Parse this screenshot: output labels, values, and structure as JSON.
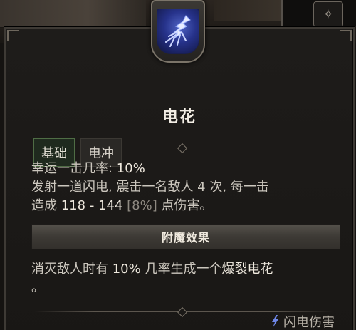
{
  "skill": {
    "name": "电花",
    "icon": "lightning-bolt-icon",
    "icon_colors": {
      "glow": "#4f63c4",
      "deep": "#10153f"
    }
  },
  "tags": [
    {
      "label": "基础",
      "style": "primary"
    },
    {
      "label": "电冲",
      "style": "secondary"
    }
  ],
  "stats": {
    "lucky_hit_label": "幸运一击几率: ",
    "lucky_hit_value": "10%",
    "desc_line1": "发射一道闪电, 震击一名敌人 4 次, 每一击",
    "desc_prefix": "造成 ",
    "damage_range": "118 - 144",
    "damage_pct": " [8%]",
    "desc_suffix": " 点伤害。"
  },
  "enchantment": {
    "header": "附魔效果",
    "text_prefix": "消灭敌人时有 ",
    "chance": "10%",
    "text_mid": " 几率生成一个",
    "linked_skill": "爆裂电花",
    "text_end": "。"
  },
  "damage_type": {
    "label": "闪电伤害",
    "icon": "lightning-small-icon"
  },
  "colors": {
    "panel": "#1e1c1a",
    "primary_tag_border": "#4f6d45",
    "text": "#cbc6bd",
    "highlight": "#efe9de"
  }
}
